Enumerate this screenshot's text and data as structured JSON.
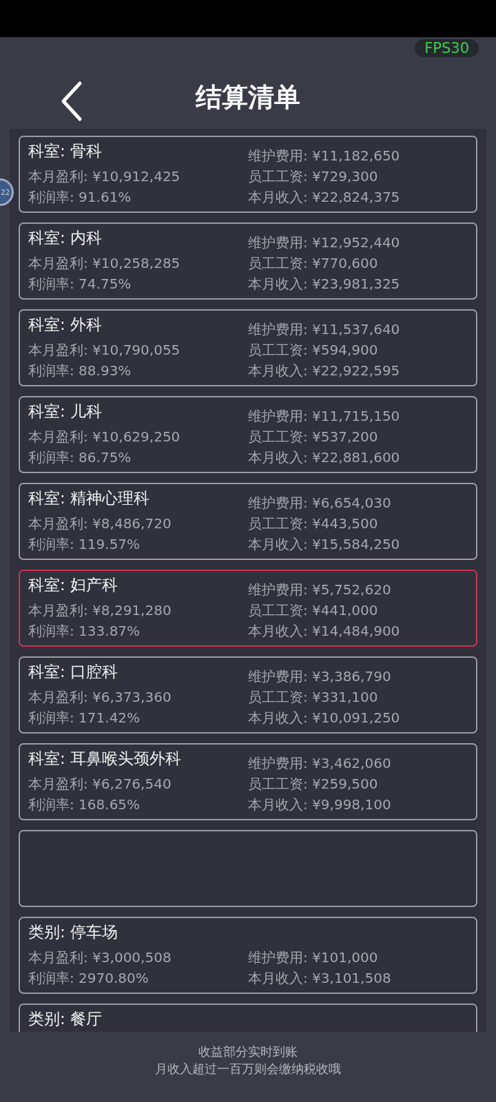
{
  "fps_badge": "FPS30",
  "title": "结算清单",
  "floating_badge": "22",
  "cards": [
    {
      "kind": "entry",
      "title": "科室: 骨科",
      "selected": false,
      "left": [
        "本月盈利: ¥10,912,425",
        "利润率: 91.61%"
      ],
      "right": [
        "维护费用: ¥11,182,650",
        "员工工资: ¥729,300",
        "本月收入: ¥22,824,375"
      ]
    },
    {
      "kind": "entry",
      "title": "科室: 内科",
      "selected": false,
      "left": [
        "本月盈利: ¥10,258,285",
        "利润率: 74.75%"
      ],
      "right": [
        "维护费用: ¥12,952,440",
        "员工工资: ¥770,600",
        "本月收入: ¥23,981,325"
      ]
    },
    {
      "kind": "entry",
      "title": "科室: 外科",
      "selected": false,
      "left": [
        "本月盈利: ¥10,790,055",
        "利润率: 88.93%"
      ],
      "right": [
        "维护费用: ¥11,537,640",
        "员工工资: ¥594,900",
        "本月收入: ¥22,922,595"
      ]
    },
    {
      "kind": "entry",
      "title": "科室: 儿科",
      "selected": false,
      "left": [
        "本月盈利: ¥10,629,250",
        "利润率: 86.75%"
      ],
      "right": [
        "维护费用: ¥11,715,150",
        "员工工资: ¥537,200",
        "本月收入: ¥22,881,600"
      ]
    },
    {
      "kind": "entry",
      "title": "科室: 精神心理科",
      "selected": false,
      "left": [
        "本月盈利: ¥8,486,720",
        "利润率: 119.57%"
      ],
      "right": [
        "维护费用: ¥6,654,030",
        "员工工资: ¥443,500",
        "本月收入: ¥15,584,250"
      ]
    },
    {
      "kind": "entry",
      "title": "科室: 妇产科",
      "selected": true,
      "left": [
        "本月盈利: ¥8,291,280",
        "利润率: 133.87%"
      ],
      "right": [
        "维护费用: ¥5,752,620",
        "员工工资: ¥441,000",
        "本月收入: ¥14,484,900"
      ]
    },
    {
      "kind": "entry",
      "title": "科室: 口腔科",
      "selected": false,
      "left": [
        "本月盈利: ¥6,373,360",
        "利润率: 171.42%"
      ],
      "right": [
        "维护费用: ¥3,386,790",
        "员工工资: ¥331,100",
        "本月收入: ¥10,091,250"
      ]
    },
    {
      "kind": "entry",
      "title": "科室: 耳鼻喉头颈外科",
      "selected": false,
      "left": [
        "本月盈利: ¥6,276,540",
        "利润率: 168.65%"
      ],
      "right": [
        "维护费用: ¥3,462,060",
        "员工工资: ¥259,500",
        "本月收入: ¥9,998,100"
      ]
    },
    {
      "kind": "empty",
      "selected": false
    },
    {
      "kind": "entry",
      "title": "类别: 停车场",
      "selected": false,
      "left": [
        "本月盈利: ¥3,000,508",
        "利润率: 2970.80%"
      ],
      "right": [
        "维护费用: ¥101,000",
        "本月收入: ¥3,101,508"
      ]
    },
    {
      "kind": "entry",
      "title": "类别: 餐厅",
      "selected": false
    }
  ],
  "footer": [
    "收益部分实时到账",
    "月收入超过一百万则会缴纳税收哦"
  ]
}
